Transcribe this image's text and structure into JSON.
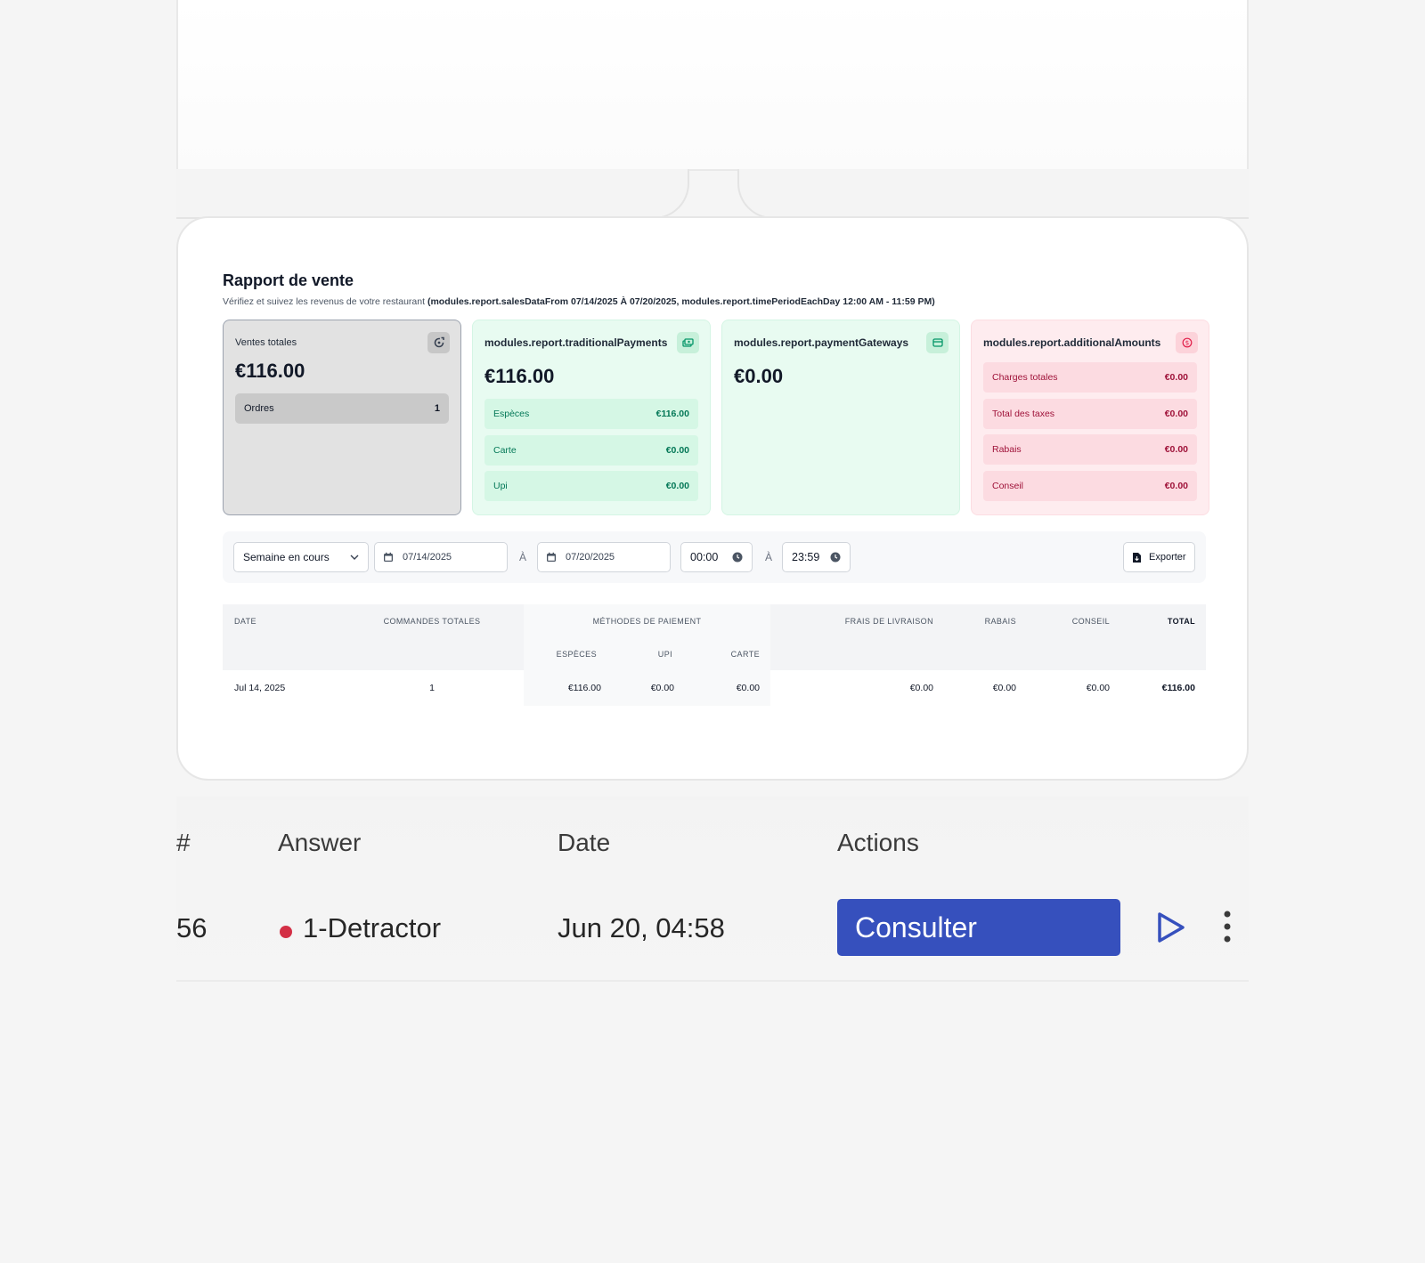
{
  "report": {
    "title": "Rapport de vente",
    "subtitle_prefix": "Vérifiez et suivez les revenus de votre restaurant",
    "subtitle_bold": "(modules.report.salesDataFrom 07/14/2025 À 07/20/2025, modules.report.timePeriodEachDay 12:00 AM - 11:59 PM)",
    "cards": {
      "total": {
        "label": "Ventes totales",
        "amount": "€116.00",
        "orders_label": "Ordres",
        "orders_value": "1",
        "icon": "refresh-chart-icon"
      },
      "traditional": {
        "label": "modules.report.traditionalPayments",
        "amount": "€116.00",
        "icon": "cash-icon",
        "rows": [
          {
            "label": "Espèces",
            "value": "€116.00"
          },
          {
            "label": "Carte",
            "value": "€0.00"
          },
          {
            "label": "Upi",
            "value": "€0.00"
          }
        ]
      },
      "gateways": {
        "label": "modules.report.paymentGateways",
        "amount": "€0.00",
        "icon": "credit-card-icon"
      },
      "additional": {
        "label": "modules.report.additionalAmounts",
        "icon": "dollar-circle-icon",
        "rows": [
          {
            "label": "Charges totales",
            "value": "€0.00"
          },
          {
            "label": "Total des taxes",
            "value": "€0.00"
          },
          {
            "label": "Rabais",
            "value": "€0.00"
          },
          {
            "label": "Conseil",
            "value": "€0.00"
          }
        ]
      }
    },
    "filters": {
      "period": "Semaine en cours",
      "date_from": "07/14/2025",
      "separator": "À",
      "date_to": "07/20/2025",
      "time_from": "00:00",
      "time_to": "23:59",
      "export_label": "Exporter"
    },
    "table": {
      "headers": {
        "date": "DATE",
        "orders": "COMMANDES TOTALES",
        "payment_methods": "MÉTHODES DE PAIEMENT",
        "cash": "ESPÈCES",
        "upi": "UPI",
        "card": "CARTE",
        "delivery": "FRAIS DE LIVRAISON",
        "discount": "RABAIS",
        "tip": "CONSEIL",
        "total": "TOTAL"
      },
      "rows": [
        {
          "date": "Jul 14, 2025",
          "orders": "1",
          "cash": "€116.00",
          "upi": "€0.00",
          "card": "€0.00",
          "delivery": "€0.00",
          "discount": "€0.00",
          "tip": "€0.00",
          "total": "€116.00"
        }
      ]
    }
  },
  "responses": {
    "headers": {
      "number": "#",
      "answer": "Answer",
      "date": "Date",
      "actions": "Actions"
    },
    "row": {
      "number": "56",
      "answer": "1-Detractor",
      "date": "Jun 20, 04:58",
      "action_label": "Consulter"
    },
    "colors": {
      "detractor_dot": "#d32f45",
      "action_button": "#3650bd",
      "play_icon": "#3650bd"
    }
  }
}
